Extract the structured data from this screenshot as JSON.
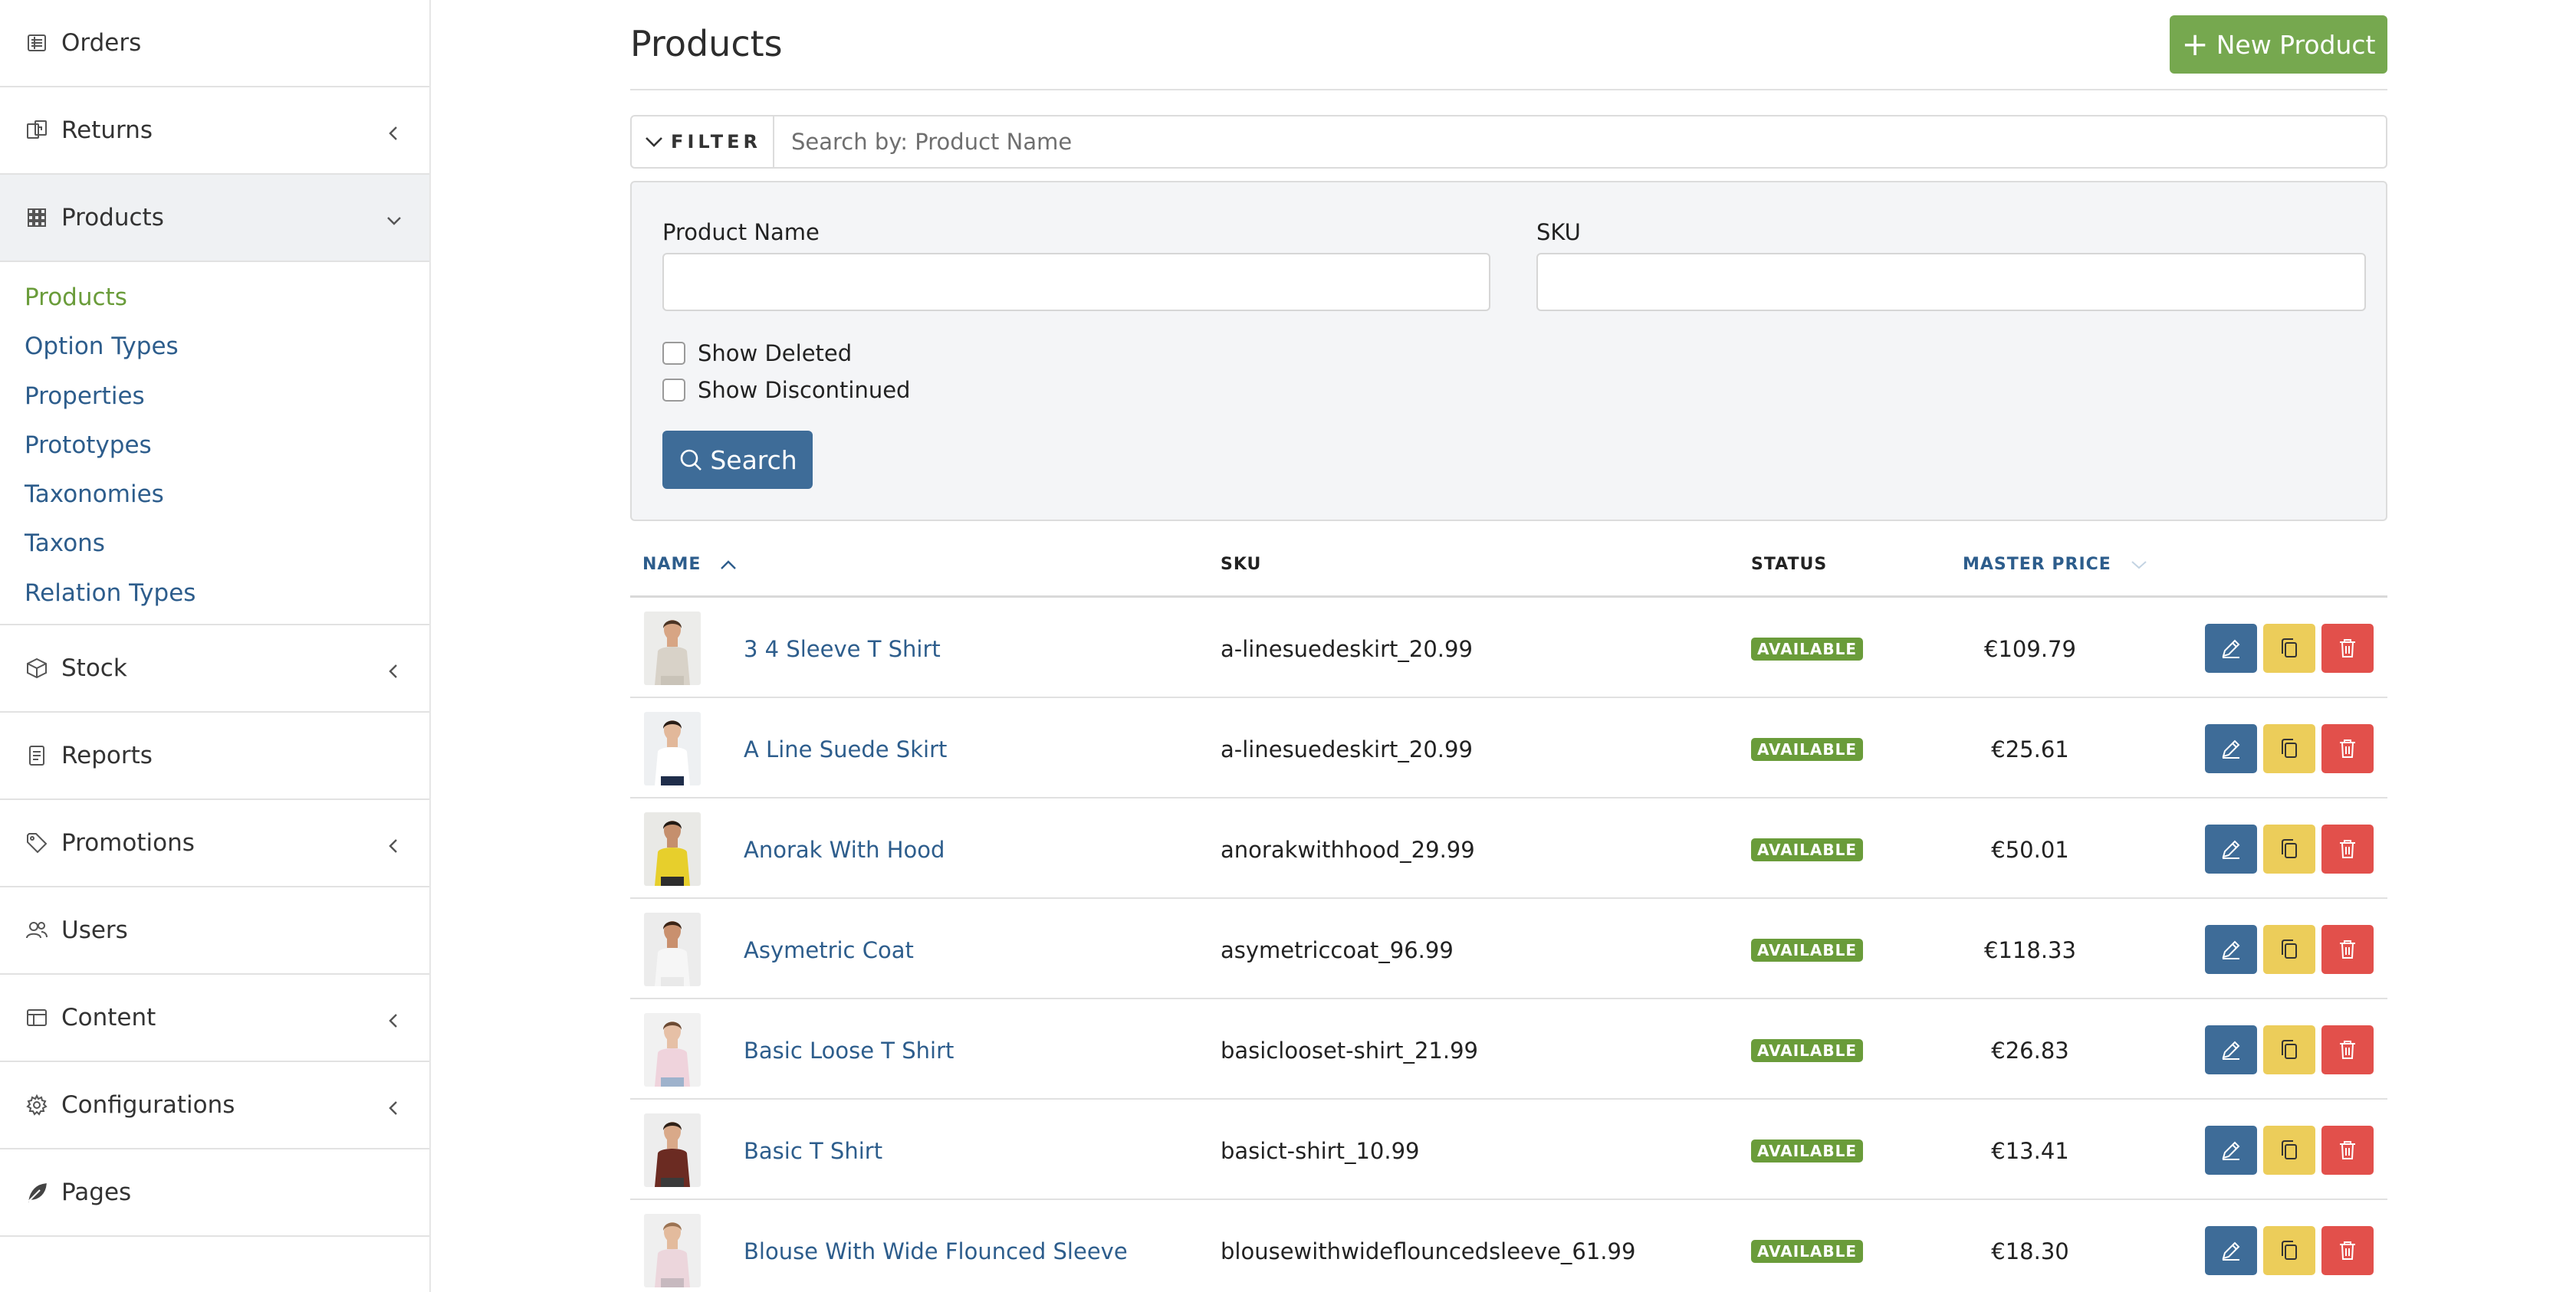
{
  "sidebar": {
    "items": [
      {
        "label": "Orders"
      },
      {
        "label": "Returns"
      },
      {
        "label": "Products"
      },
      {
        "label": "Stock"
      },
      {
        "label": "Reports"
      },
      {
        "label": "Promotions"
      },
      {
        "label": "Users"
      },
      {
        "label": "Content"
      },
      {
        "label": "Configurations"
      },
      {
        "label": "Pages"
      }
    ],
    "sub_items": [
      {
        "label": "Products"
      },
      {
        "label": "Option Types"
      },
      {
        "label": "Properties"
      },
      {
        "label": "Prototypes"
      },
      {
        "label": "Taxonomies"
      },
      {
        "label": "Taxons"
      },
      {
        "label": "Relation Types"
      }
    ]
  },
  "header": {
    "title": "Products",
    "new_button_label": "New Product"
  },
  "filter": {
    "toggle_label": "FILTER",
    "search_placeholder": "Search by: Product Name",
    "product_name_label": "Product Name",
    "sku_label": "SKU",
    "show_deleted_label": "Show Deleted",
    "show_discontinued_label": "Show Discontinued",
    "search_button_label": "Search"
  },
  "table": {
    "columns": {
      "name": "NAME",
      "sku": "SKU",
      "status": "STATUS",
      "master_price": "MASTER PRICE"
    },
    "rows": [
      {
        "name": "3 4 Sleeve T Shirt",
        "sku": "a-linesuedeskirt_20.99",
        "status": "AVAILABLE",
        "price": "€109.79",
        "thumb": {
          "bg": "#ececea",
          "skin": "#d7a584",
          "hair": "#4b3424",
          "top": "#d8d2c8",
          "bottom": "#c9c3b8"
        }
      },
      {
        "name": "A Line Suede Skirt",
        "sku": "a-linesuedeskirt_20.99",
        "status": "AVAILABLE",
        "price": "€25.61",
        "thumb": {
          "bg": "#eef0f2",
          "skin": "#e2b89a",
          "hair": "#2a1d16",
          "top": "#ffffff",
          "bottom": "#1f2d4a"
        }
      },
      {
        "name": "Anorak With Hood",
        "sku": "anorakwithhood_29.99",
        "status": "AVAILABLE",
        "price": "€50.01",
        "thumb": {
          "bg": "#e9e9e6",
          "skin": "#c58f6d",
          "hair": "#231a14",
          "top": "#e7cf2c",
          "bottom": "#2d2d2d"
        }
      },
      {
        "name": "Asymetric Coat",
        "sku": "asymetriccoat_96.99",
        "status": "AVAILABLE",
        "price": "€118.33",
        "thumb": {
          "bg": "#ececec",
          "skin": "#c9906e",
          "hair": "#3b2416",
          "top": "#f6f6f6",
          "bottom": "#e9e9e9"
        }
      },
      {
        "name": "Basic Loose T Shirt",
        "sku": "basiclooset-shirt_21.99",
        "status": "AVAILABLE",
        "price": "€26.83",
        "thumb": {
          "bg": "#f1f1f1",
          "skin": "#e6c0a6",
          "hair": "#6b4a33",
          "top": "#efd3dc",
          "bottom": "#9eb2cc"
        }
      },
      {
        "name": "Basic T Shirt",
        "sku": "basict-shirt_10.99",
        "status": "AVAILABLE",
        "price": "€13.41",
        "thumb": {
          "bg": "#ededed",
          "skin": "#d9a989",
          "hair": "#2f2118",
          "top": "#6b2b22",
          "bottom": "#3a3a3a"
        }
      },
      {
        "name": "Blouse With Wide Flounced Sleeve",
        "sku": "blousewithwideflouncedsleeve_61.99",
        "status": "AVAILABLE",
        "price": "€18.30",
        "thumb": {
          "bg": "#efefef",
          "skin": "#e3bb9d",
          "hair": "#9b7353",
          "top": "#ecd6dc",
          "bottom": "#c7b9bf"
        }
      }
    ]
  },
  "colors": {
    "link_blue": "#2d5d8c",
    "active_green": "#6a9c3a",
    "new_button_green": "#76a84f",
    "edit_blue": "#3e6c98",
    "clone_yellow": "#eccd5a",
    "delete_red": "#e2504b"
  },
  "icons": {
    "nav": [
      "orders-icon",
      "returns-icon",
      "products-grid-icon",
      "stock-box-icon",
      "reports-icon",
      "promotions-tag-icon",
      "users-icon",
      "content-layout-icon",
      "configurations-gear-icon",
      "pages-leaf-icon"
    ],
    "row_actions": [
      "pencil-icon",
      "copy-icon",
      "trash-icon"
    ]
  }
}
